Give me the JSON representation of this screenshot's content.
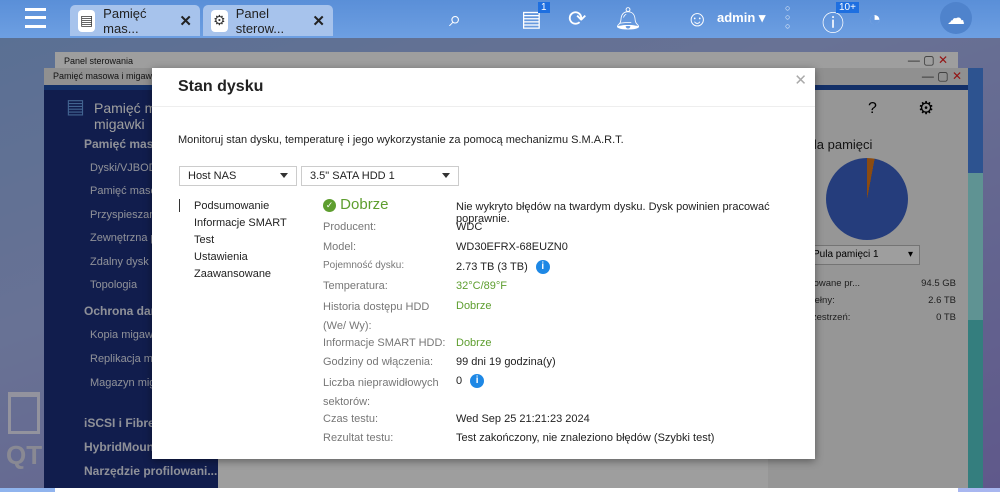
{
  "topbar": {
    "tabs": [
      {
        "label": "Pamięć mas...",
        "icon": "storage-icon"
      },
      {
        "label": "Panel sterow...",
        "icon": "gear-icon"
      }
    ],
    "user": "admin",
    "tasks_badge": "1",
    "notif_badge": "10+"
  },
  "control_panel": {
    "title": "Panel sterowania"
  },
  "storage_window": {
    "title": "Pamięć masowa i migawki",
    "app_title": "Pamięć masowa i migawki",
    "sidebar": [
      {
        "label": "Pamięć masowa",
        "section": true
      },
      {
        "label": "Dyski/VJBOD"
      },
      {
        "label": "Pamięć masowa"
      },
      {
        "label": "Przyspieszanie"
      },
      {
        "label": "Zewnętrzna pamięć"
      },
      {
        "label": "Zdalny dysk"
      },
      {
        "label": "Topologia"
      },
      {
        "label": "Ochrona danych",
        "section": true
      },
      {
        "label": "Kopia migawki"
      },
      {
        "label": "Replikacja migawki"
      },
      {
        "label": "Magazyn migawek"
      },
      {
        "label": "iSCSI i Fibre Channel",
        "section": true
      },
      {
        "label": "HybridMount",
        "section": true
      },
      {
        "label": "Narzędzie profilowani...",
        "section": true
      }
    ],
    "right_panel": {
      "title": "Pula pamięci",
      "pool_select": "Pula pamięci 1",
      "stats": [
        {
          "label": "Zarezerwowane pr...",
          "value": "94.5 GB"
        },
        {
          "label": "Minimin pełny:",
          "value": "2.6 TB"
        },
        {
          "label": "Wolna przestrzeń:",
          "value": "0 TB"
        }
      ]
    },
    "desktop_label": "QT"
  },
  "modal": {
    "title": "Stan dysku",
    "description": "Monitoruj stan dysku, temperaturę i jego wykorzystanie za pomocą mechanizmu S.M.A.R.T.",
    "host_select": "Host NAS",
    "disk_select": "3.5\" SATA HDD 1",
    "nav": [
      "Podsumowanie",
      "Informacje SMART",
      "Test",
      "Ustawienia",
      "Zaawansowane"
    ],
    "status": "Dobrze",
    "status_message": "Nie wykryto błędów na twardym dysku. Dysk powinien pracować poprawnie.",
    "fields": [
      {
        "label": "Producent:",
        "value": "WDC"
      },
      {
        "label": "Model:",
        "value": "WD30EFRX-68EUZN0"
      },
      {
        "label": "Pojemność dysku:",
        "value": "2.73 TB (3 TB)"
      },
      {
        "label": "Temperatura:",
        "value": "32°C/89°F"
      },
      {
        "label": "Historia dostępu HDD (We/ Wy):",
        "value": "Dobrze"
      },
      {
        "label": "Informacje SMART HDD:",
        "value": "Dobrze"
      },
      {
        "label": "Godziny od włączenia:",
        "value": "99 dni 19 godzina(y)"
      },
      {
        "label": "Liczba nieprawidłowych sektorów:",
        "value": "0"
      },
      {
        "label": "Czas testu:",
        "value": "Wed Sep 25 21:21:23 2024"
      },
      {
        "label": "Rezultat testu:",
        "value": "Test zakończony, nie znaleziono błędów (Szybki test)"
      }
    ]
  },
  "colors": {
    "accent": "#1e88e5",
    "good": "#5e9e2f",
    "sidebar": "#1c2f7c"
  }
}
